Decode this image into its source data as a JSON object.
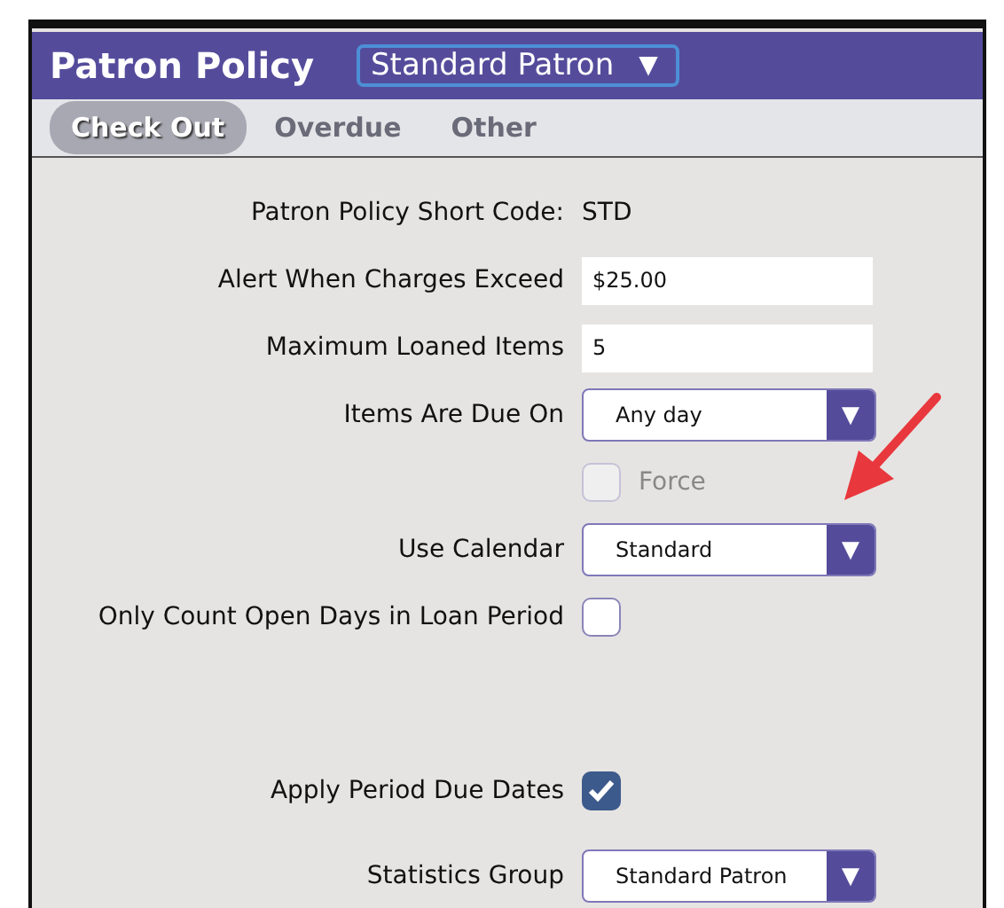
{
  "header": {
    "title": "Patron Policy",
    "policy_select": {
      "value": "Standard Patron",
      "caret": "▼"
    }
  },
  "tabs": [
    {
      "label": "Check Out",
      "selected": true
    },
    {
      "label": "Overdue",
      "selected": false
    },
    {
      "label": "Other",
      "selected": false
    }
  ],
  "fields": [
    {
      "kind": "text",
      "label": "Patron Policy Short Code:",
      "value": "STD"
    },
    {
      "kind": "input",
      "label": "Alert When Charges Exceed",
      "value": "$25.00"
    },
    {
      "kind": "input",
      "label": "Maximum Loaned Items",
      "value": "5"
    },
    {
      "kind": "select",
      "label": "Items Are Due On",
      "value": "Any day",
      "caret": "▼"
    },
    {
      "kind": "checkbox",
      "option": "Force",
      "checked": false,
      "disabled": true
    },
    {
      "kind": "select",
      "label": "Use Calendar",
      "value": "Standard",
      "caret": "▼"
    },
    {
      "kind": "checkbox",
      "label": "Only Count Open Days in Loan Period",
      "checked": false,
      "disabled": false
    },
    {
      "kind": "checkbox",
      "label": "Apply Period Due Dates",
      "checked": true,
      "disabled": false
    },
    {
      "kind": "select",
      "label": "Statistics Group",
      "value": "Standard Patron",
      "caret": "▼"
    }
  ]
}
